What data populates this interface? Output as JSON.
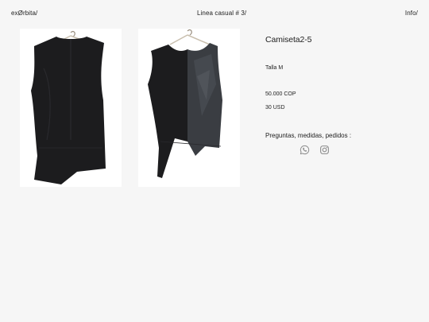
{
  "header": {
    "brand": "exØrbita/",
    "collection": "Linea casual # 3/",
    "info": "Info/"
  },
  "product": {
    "title": "Camiseta2-5",
    "size": "Talla M",
    "price_cop": "50.000 COP",
    "price_usd": "30 USD",
    "contact_prompt": "Preguntas, medidas, pedidos :"
  },
  "photos": [
    {
      "view": "back",
      "icon": "garment-back-photo"
    },
    {
      "view": "front",
      "icon": "garment-front-photo"
    }
  ],
  "socials": [
    {
      "name": "whatsapp",
      "icon": "whatsapp-icon"
    },
    {
      "name": "instagram",
      "icon": "instagram-icon"
    }
  ],
  "colors": {
    "background": "#f6f6f6",
    "text": "#222222",
    "garment": "#1c1c1e",
    "garment_panel": "#3a3d42",
    "icon": "#8a8a8a"
  }
}
